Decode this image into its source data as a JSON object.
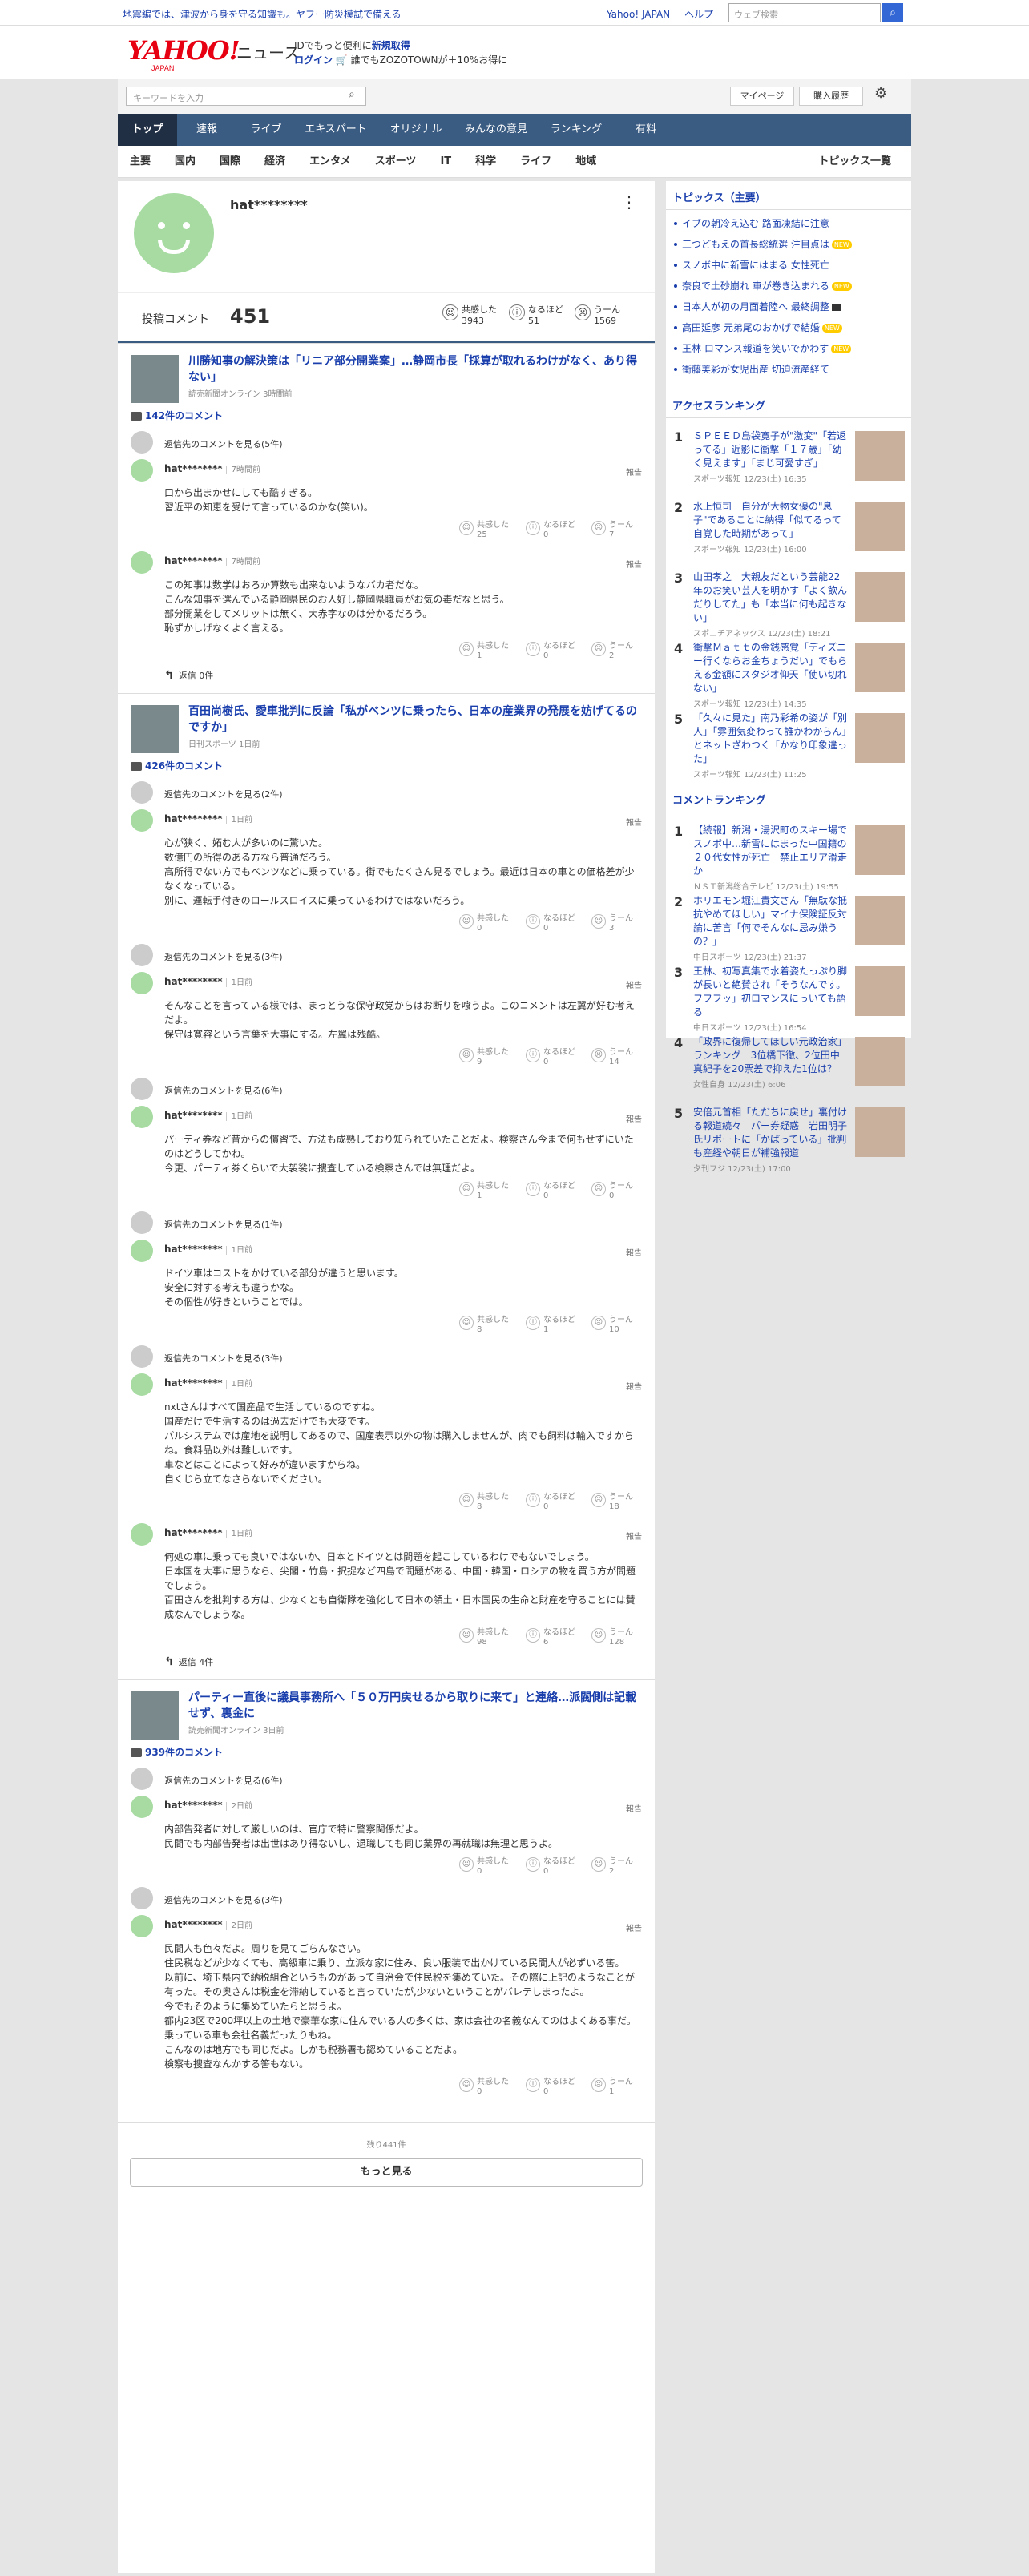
{
  "topbar": {
    "notice": "地震編では、津波から身を守る知識も。ヤフー防災模試で備える",
    "links": [
      "Yahoo! JAPAN",
      "ヘルプ"
    ],
    "search_placeholder": "ウェブ検索"
  },
  "header": {
    "logo": "YAHOO!",
    "logo_sub": "JAPAN",
    "site": "ニュース",
    "promo_line1_pre": "IDでもっと便利に",
    "promo_line1_link": "新規取得",
    "promo_line2_link": "ログイン",
    "promo_line2": " 🛒 誰でもZOZOTOWNが＋10%お得に"
  },
  "search": {
    "placeholder": "キーワードを入力",
    "mypage": "マイページ",
    "purchase": "購入履歴"
  },
  "gnav": [
    "トップ",
    "速報",
    "ライブ",
    "エキスパート",
    "オリジナル",
    "みんなの意見",
    "ランキング",
    "有料"
  ],
  "cnav": [
    "主要",
    "国内",
    "国際",
    "経済",
    "エンタメ",
    "スポーツ",
    "IT",
    "科学",
    "ライフ",
    "地域"
  ],
  "cnav_right": "トピックス一覧",
  "profile": {
    "name": "hat********",
    "label": "投稿コメント",
    "count": "451",
    "reactions": [
      {
        "label": "共感した",
        "value": "3943"
      },
      {
        "label": "なるほど",
        "value": "51"
      },
      {
        "label": "うーん",
        "value": "1569"
      }
    ]
  },
  "ui": {
    "report": "報告",
    "rl1": "共感した",
    "rl2": "なるほど",
    "rl3": "うーん",
    "reply_label": "返信",
    "view_replies": "返信先のコメントを見る"
  },
  "articles": [
    {
      "title": "川勝知事の解決策は「リニア部分開業案」…静岡市長「採算が取れるわけがなく、あり得ない」",
      "source": "読売新聞オンライン 3時間前",
      "count": "142件のコメント",
      "comments": [
        {
          "parent": "返信先のコメントを見る(5件)",
          "name": "hat********",
          "time": "7時間前",
          "lines": [
            "口から出まかせにしても酷すぎる。",
            "習近平の知恵を受けて言っているのかな(笑い)。"
          ],
          "r": [
            "25",
            "0",
            "7"
          ]
        },
        {
          "parent": "",
          "name": "hat********",
          "time": "7時間前",
          "lines": [
            "この知事は数学はおろか算数も出来ないようなバカ者だな。",
            "こんな知事を選んでいる静岡県民のお人好し静岡県職員がお気の毒だなと思う。",
            "部分開業をしてメリットは無く、大赤字なのは分かるだろう。",
            "恥ずかしげなくよく言える。"
          ],
          "r": [
            "1",
            "0",
            "2"
          ],
          "reply": "返信 0件"
        }
      ]
    },
    {
      "title": "百田尚樹氏、愛車批判に反論「私がベンツに乗ったら、日本の産業界の発展を妨げてるのですか」",
      "source": "日刊スポーツ 1日前",
      "count": "426件のコメント",
      "comments": [
        {
          "parent": "返信先のコメントを見る(2件)",
          "name": "hat********",
          "time": "1日前",
          "lines": [
            "心が狭く、妬む人が多いのに驚いた。",
            "数億円の所得のある方なら普通だろう。",
            "高所得でない方でもベンツなどに乗っている。街でもたくさん見るでしょう。最近は日本の車との価格差が少なくなっている。",
            "別に、運転手付きのロールスロイスに乗っているわけではないだろう。"
          ],
          "r": [
            "0",
            "0",
            "3"
          ]
        },
        {
          "parent": "返信先のコメントを見る(3件)",
          "name": "hat********",
          "time": "1日前",
          "lines": [
            "そんなことを言っている様では、まっとうな保守政党からはお断りを喰うよ。このコメントは左翼が好む考えだよ。",
            "保守は寛容という言葉を大事にする。左翼は残酷。"
          ],
          "r": [
            "9",
            "0",
            "14"
          ]
        },
        {
          "parent": "返信先のコメントを見る(6件)",
          "name": "hat********",
          "time": "1日前",
          "lines": [
            "パーティ券など昔からの慣習で、方法も成熟しており知られていたことだよ。検察さん今まで何もせずにいたのはどうしてかね。",
            "今更、パーティ券くらいで大袈裟に捜査している検察さんでは無理だよ。"
          ],
          "r": [
            "1",
            "0",
            "0"
          ]
        },
        {
          "parent": "返信先のコメントを見る(1件)",
          "name": "hat********",
          "time": "1日前",
          "lines": [
            "ドイツ車はコストをかけている部分が違うと思います。",
            "安全に対する考えも違うかな。",
            "その個性が好きということでは。"
          ],
          "r": [
            "8",
            "1",
            "10"
          ]
        },
        {
          "parent": "返信先のコメントを見る(3件)",
          "name": "hat********",
          "time": "1日前",
          "lines": [
            "nxtさんはすべて国産品で生活しているのですね。",
            "国産だけで生活するのは過去だけでも大変です。",
            "パルシステムでは産地を説明してあるので、国産表示以外の物は購入しませんが、肉でも飼料は輸入ですからね。食料品以外は難しいです。",
            "車などはことによって好みが違いますからね。",
            "自くじら立てなさらないでください。"
          ],
          "r": [
            "8",
            "0",
            "18"
          ]
        },
        {
          "parent": "",
          "name": "hat********",
          "time": "1日前",
          "lines": [
            "何処の車に乗っても良いではないか、日本とドイツとは問題を起こしているわけでもないでしょう。",
            "日本国を大事に思うなら、尖閣・竹島・択捉など四島で問題がある、中国・韓国・ロシアの物を買う方が問題でしょう。",
            "百田さんを批判する方は、少なくとも自衛隊を強化して日本の領土・日本国民の生命と財産を守ることには賛成なんでしょうな。"
          ],
          "r": [
            "98",
            "6",
            "128"
          ],
          "reply": "返信 4件"
        }
      ]
    },
    {
      "title": "パーティー直後に議員事務所へ「５０万円戻せるから取りに来て」と連絡…派閥側は記載せず、裏金に",
      "source": "読売新聞オンライン 3日前",
      "count": "939件のコメント",
      "comments": [
        {
          "parent": "返信先のコメントを見る(6件)",
          "name": "hat********",
          "time": "2日前",
          "lines": [
            "内部告発者に対して厳しいのは、官庁で特に警察関係だよ。",
            "民間でも内部告発者は出世はあり得ないし、退職しても同じ業界の再就職は無理と思うよ。"
          ],
          "r": [
            "0",
            "0",
            "2"
          ]
        },
        {
          "parent": "返信先のコメントを見る(3件)",
          "name": "hat********",
          "time": "2日前",
          "lines": [
            "民間人も色々だよ。周りを見てごらんなさい。",
            "住民税などが少なくても、高級車に乗り、立派な家に住み、良い服装で出かけている民間人が必ずいる筈。",
            "以前に、埼玉県内で納税組合というものがあって自治会で住民税を集めていた。その際に上記のようなことが有った。その奥さんは税金を滞納していると言っていたが,少ないということがバレテしまったよ。",
            "今でもそのように集めていたらと思うよ。",
            "都内23区で200坪以上の土地で豪華な家に住んでいる人の多くは、家は会社の名義なんてのはよくある事だ。乗っている車も会社名義だったりもね。",
            "こんなのは地方でも同じだよ。しかも税務署も認めていることだよ。",
            "検察も捜査なんかする筈もない。"
          ],
          "r": [
            "0",
            "0",
            "1"
          ]
        }
      ]
    }
  ],
  "footer": {
    "rest": "残り441件",
    "more": "もっと見る"
  },
  "side": {
    "topics_title": "トピックス（主要）",
    "topics": [
      {
        "t": "イブの朝冷え込む 路面凍結に注意",
        "badge": ""
      },
      {
        "t": "三つどもえの首長総統選 注目点は",
        "badge": "NEW"
      },
      {
        "t": "スノボ中に新雪にはまる 女性死亡",
        "badge": ""
      },
      {
        "t": "奈良で土砂崩れ 車が巻き込まれる",
        "badge": "NEW"
      },
      {
        "t": "日本人が初の月面着陸へ 最終調整",
        "badge": "cam"
      },
      {
        "t": "高田延彦 元弟尾のおかげで結婚",
        "badge": "NEW"
      },
      {
        "t": "王林 ロマンス報道を笑いでかわす",
        "badge": "NEW"
      },
      {
        "t": "衝藤美彩が女児出産 切迫流産経て",
        "badge": ""
      }
    ],
    "access_title": "アクセスランキング",
    "access": [
      {
        "n": "1",
        "t": "ＳＰＥＥＤ島袋寛子が\"激変\"「若返ってる」近影に衝撃「１７歳」「幼く見えます」「まじ可愛すぎ」",
        "s": "スポーツ報知 12/23(土) 16:35"
      },
      {
        "n": "2",
        "t": "水上恒司　自分が大物女優の\"息子\"であることに納得「似てるって自覚した時期があって」",
        "s": "スポーツ報知 12/23(土) 16:00"
      },
      {
        "n": "3",
        "t": "山田孝之　大親友だという芸能22年のお笑い芸人を明かす「よく飲んだりしてた」も「本当に何も起きない」",
        "s": "スポニチアネックス 12/23(土) 18:21"
      },
      {
        "n": "4",
        "t": "衝撃Ｍａｔｔの金銭感覚「ディズニー行くならお金ちょうだい」でもらえる金額にスタジオ仰天「使い切れない」",
        "s": "スポーツ報知 12/23(土) 14:35"
      },
      {
        "n": "5",
        "t": "「久々に見た」南乃彩希の姿が「別人」「雰囲気変わって誰かわからん」とネットざわつく「かなり印象違った」",
        "s": "スポーツ報知 12/23(土) 11:25"
      }
    ],
    "comment_title": "コメントランキング",
    "crank": [
      {
        "n": "1",
        "t": "【続報】新潟・湯沢町のスキー場でスノボ中…新雪にはまった中国籍の２０代女性が死亡　禁止エリア滑走か",
        "s": "ＮＳＴ新潟総合テレビ 12/23(土) 19:55"
      },
      {
        "n": "2",
        "t": "ホリエモン堀江貴文さん「無駄な抵抗やめてほしい」マイナ保険証反対論に苦言「何でそんなに忌み嫌うの？」",
        "s": "中日スポーツ 12/23(土) 21:37"
      },
      {
        "n": "3",
        "t": "王林、初写真集で水着姿たっぷり脚が長いと絶賛され「そうなんです。フフフッ」初ロマンスにっいても語る",
        "s": "中日スポーツ 12/23(土) 16:54"
      },
      {
        "n": "4",
        "t": "「政界に復帰してほしい元政治家」ランキング　3位橋下徹、2位田中真紀子を20票差で抑えた1位は？",
        "s": "女性自身 12/23(土) 6:06"
      },
      {
        "n": "5",
        "t": "安倍元首相「ただちに戻せ」裏付ける報道続々　パー券疑惑　岩田明子氏リポートに「かばっている」批判も産経や朝日が補強報道",
        "s": "夕刊フジ 12/23(土) 17:00"
      }
    ]
  }
}
